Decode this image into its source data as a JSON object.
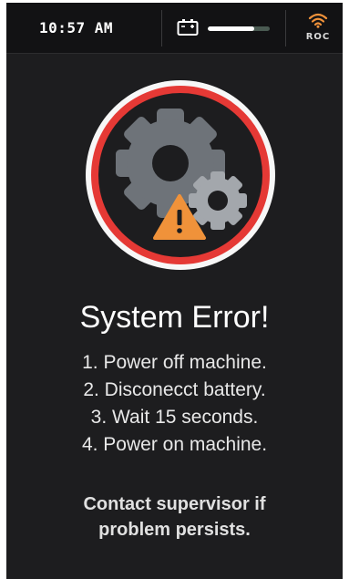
{
  "status_bar": {
    "time": "10:57 AM",
    "battery_level_percent": 75,
    "network_label": "ROC",
    "icons": [
      "battery-icon",
      "wifi-icon"
    ]
  },
  "error_screen": {
    "icons": [
      "large-gear-icon",
      "small-gear-icon",
      "warning-triangle-icon"
    ],
    "title": "System Error!",
    "steps": [
      "1.  Power off machine.",
      "2. Disconecct battery.",
      "3. Wait 15 seconds.",
      "4. Power on machine."
    ],
    "contact_line_1": "Contact supervisor if",
    "contact_line_2": "problem persists."
  },
  "colors": {
    "background": "#1d1d1f",
    "status_bar": "#121214",
    "error_ring": "#e53935",
    "gear_large": "#6e7379",
    "gear_small": "#a3a7ac",
    "warning": "#f0923a",
    "wifi": "#f0923a"
  }
}
